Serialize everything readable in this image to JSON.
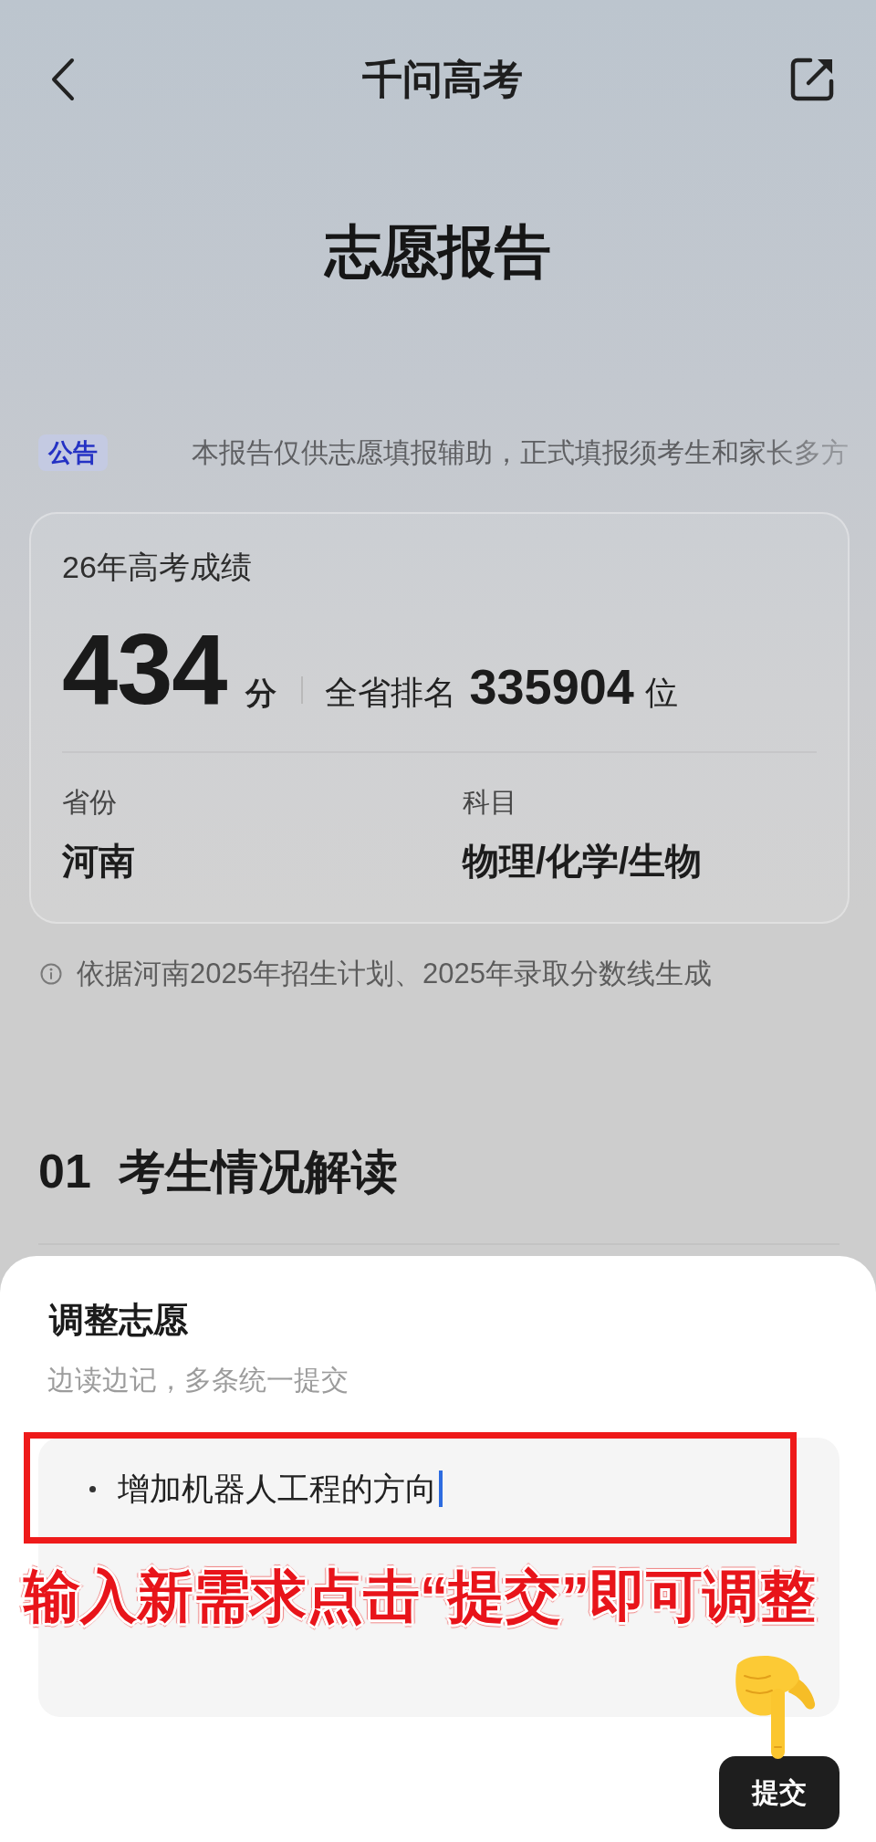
{
  "header": {
    "title": "千问高考"
  },
  "page_title": "志愿报告",
  "notice": {
    "badge": "公告",
    "text": "本报告仅供志愿填报辅助，正式填报须考生和家长多方"
  },
  "score_card": {
    "title": "26年高考成绩",
    "score": "434",
    "score_unit": "分",
    "rank_label": "全省排名",
    "rank": "335904",
    "rank_unit": "位",
    "fields": [
      {
        "label": "省份",
        "value": "河南"
      },
      {
        "label": "科目",
        "value": "物理/化学/生物"
      }
    ]
  },
  "source_note": "依据河南2025年招生计划、2025年录取分数线生成",
  "section": {
    "number": "01",
    "title": "考生情况解读"
  },
  "sheet": {
    "title": "调整志愿",
    "subtitle": "边读边记，多条统一提交",
    "editor": {
      "focused": true,
      "entries": [
        "增加机器人工程的方向"
      ]
    },
    "submit_button": "提交"
  },
  "annotation": {
    "caption": "输入新需求点击“提交”即可调整"
  }
}
